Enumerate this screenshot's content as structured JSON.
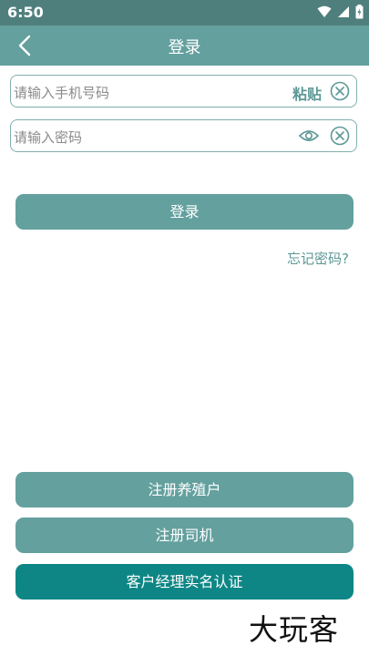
{
  "status_bar": {
    "time": "6:50"
  },
  "app_bar": {
    "title": "登录"
  },
  "phone_field": {
    "placeholder": "请输入手机号码",
    "paste_label": "粘贴"
  },
  "password_field": {
    "placeholder": "请输入密码"
  },
  "login_button": {
    "label": "登录"
  },
  "forgot_password": {
    "label": "忘记密码?"
  },
  "register_farmer_button": {
    "label": "注册养殖户"
  },
  "register_driver_button": {
    "label": "注册司机"
  },
  "manager_verify_button": {
    "label": "客户经理实名认证"
  },
  "watermark": {
    "text": "大玩客"
  },
  "colors": {
    "status_bar_bg": "#4f7f7d",
    "app_bar_bg": "#63a09e",
    "button_bg": "#63a09e",
    "button_dark_bg": "#0e8686",
    "accent_text": "#5c9896"
  },
  "icons": [
    "back-arrow-icon",
    "wifi-icon",
    "signal-icon",
    "battery-icon",
    "clear-icon",
    "eye-icon"
  ]
}
